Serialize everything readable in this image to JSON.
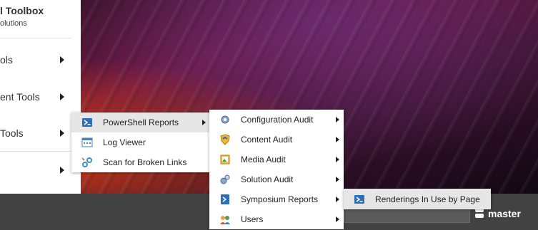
{
  "panel": {
    "title": "l Toolbox",
    "subtitle": "olutions",
    "items": [
      {
        "label": "ols"
      },
      {
        "label": "ent Tools"
      },
      {
        "label": "Tools"
      },
      {
        "label": ""
      }
    ]
  },
  "menu1": {
    "items": [
      {
        "label": "PowerShell Reports",
        "icon": "powershell-icon"
      },
      {
        "label": "Log Viewer",
        "icon": "log-viewer-icon"
      },
      {
        "label": "Scan for Broken Links",
        "icon": "broken-links-icon"
      }
    ]
  },
  "menu2": {
    "items": [
      {
        "label": "Configuration Audit",
        "icon": "gear-icon"
      },
      {
        "label": "Content Audit",
        "icon": "shield-icon"
      },
      {
        "label": "Media Audit",
        "icon": "media-icon"
      },
      {
        "label": "Solution Audit",
        "icon": "solution-gears-icon"
      },
      {
        "label": "Symposium Reports",
        "icon": "powershell-icon"
      },
      {
        "label": "Users",
        "icon": "users-icon"
      }
    ]
  },
  "menu3": {
    "items": [
      {
        "label": "Renderings In Use by Page",
        "icon": "powershell-icon"
      }
    ]
  },
  "taskbar": {
    "database": "master"
  },
  "colors": {
    "taskbar": "#424242",
    "menu_highlight": "#e6e6e6",
    "powershell_blue": "#2a6fb8"
  }
}
